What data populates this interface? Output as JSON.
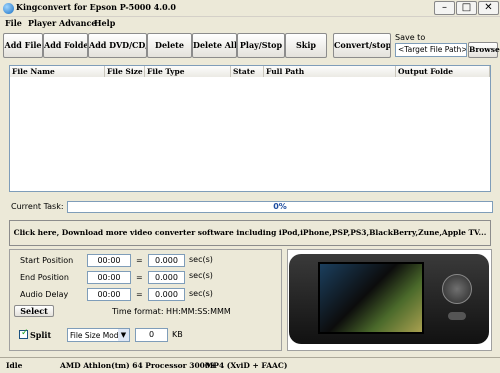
{
  "app": {
    "title": "Kingconvert for Epson P-5000 4.0.0"
  },
  "window_controls": {
    "minimize": "–",
    "maximize": "□",
    "close": "✕"
  },
  "menu": [
    "File",
    "Player",
    "Advance",
    "Help"
  ],
  "toolbar": {
    "add_file": "Add File",
    "add_folder": "Add Folder",
    "add_dvd": "Add DVD/CD/VCD",
    "delete": "Delete",
    "delete_all": "Delete All",
    "play_stop": "Play/Stop",
    "skip": "Skip",
    "convert_stop": "Convert/stop"
  },
  "save_to": {
    "label": "Save to",
    "value": "<Target File Path>",
    "browse": "Browse"
  },
  "file_list": {
    "columns": [
      "File Name",
      "File Size",
      "File Type",
      "State",
      "Full Path",
      "Output Folde"
    ]
  },
  "task": {
    "label": "Current Task:",
    "progress_text": "0%",
    "progress": 0
  },
  "banner": "Click here, Download more video converter software including iPod,iPhone,PSP,PS3,BlackBerry,Zune,Apple TV...",
  "settings": {
    "start_position": {
      "label": "Start Position",
      "time": "00:00",
      "secs": "0.000",
      "unit": "sec(s)"
    },
    "end_position": {
      "label": "End Position",
      "time": "00:00",
      "secs": "0.000",
      "unit": "sec(s)"
    },
    "audio_delay": {
      "label": "Audio Delay",
      "time": "00:00",
      "secs": "0.000",
      "unit": "sec(s)"
    },
    "equals": "=",
    "select_button": "Select",
    "time_format": "Time format: HH:MM:SS:MMM",
    "split_label": "Split",
    "split_checked": true,
    "split_mode": "File Size Mode",
    "split_value": "0",
    "split_unit": "KB"
  },
  "status": {
    "state": "Idle",
    "cpu": "AMD Athlon(tm) 64 Processor 3000+",
    "format": "MP4 (XviD + FAAC)"
  },
  "icons": {
    "app": "kingconvert-logo-icon",
    "dropdown": "chevron-down-icon",
    "check": "checkmark-icon"
  }
}
